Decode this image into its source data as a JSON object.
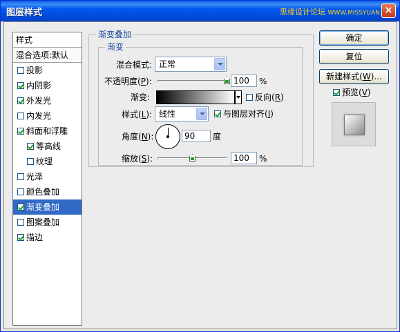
{
  "window": {
    "title": "图层样式",
    "watermark": "思缘设计论坛",
    "watermark_url": "WWW.MISSYUAN.COM",
    "close_glyph": "×"
  },
  "styles_list": {
    "header": "样式",
    "blend_options": "混合选项:默认",
    "items": [
      {
        "label": "投影",
        "checked": false,
        "sub": false,
        "selected": false
      },
      {
        "label": "内阴影",
        "checked": true,
        "sub": false,
        "selected": false
      },
      {
        "label": "外发光",
        "checked": true,
        "sub": false,
        "selected": false
      },
      {
        "label": "内发光",
        "checked": false,
        "sub": false,
        "selected": false
      },
      {
        "label": "斜面和浮雕",
        "checked": true,
        "sub": false,
        "selected": false
      },
      {
        "label": "等高线",
        "checked": true,
        "sub": true,
        "selected": false
      },
      {
        "label": "纹理",
        "checked": false,
        "sub": true,
        "selected": false
      },
      {
        "label": "光泽",
        "checked": false,
        "sub": false,
        "selected": false
      },
      {
        "label": "颜色叠加",
        "checked": false,
        "sub": false,
        "selected": false
      },
      {
        "label": "渐变叠加",
        "checked": true,
        "sub": false,
        "selected": true
      },
      {
        "label": "图案叠加",
        "checked": false,
        "sub": false,
        "selected": false
      },
      {
        "label": "描边",
        "checked": true,
        "sub": false,
        "selected": false
      }
    ]
  },
  "gradient_overlay": {
    "group_title": "渐变叠加",
    "subgroup_title": "渐变",
    "blend_mode_label": "混合模式:",
    "blend_mode_value": "正常",
    "opacity_label_pre": "不透明度(",
    "opacity_label_key": "P",
    "opacity_label_post": "):",
    "opacity_value": "100",
    "opacity_fraction": 1.0,
    "opacity_unit": "%",
    "gradient_label": "渐变:",
    "reverse_label_pre": "反向(",
    "reverse_label_key": "R",
    "reverse_label_post": ")",
    "reverse_checked": false,
    "style_label_pre": "样式(",
    "style_label_key": "L",
    "style_label_post": "):",
    "style_value": "线性",
    "align_label_pre": "与图层对齐(",
    "align_label_key": "I",
    "align_label_post": ")",
    "align_checked": true,
    "angle_label_pre": "角度(",
    "angle_label_key": "N",
    "angle_label_post": "):",
    "angle_value": "90",
    "angle_unit": "度",
    "scale_label_pre": "缩放(",
    "scale_label_key": "S",
    "scale_label_post": "):",
    "scale_value": "100",
    "scale_fraction": 0.5,
    "scale_unit": "%"
  },
  "buttons": {
    "ok": "确定",
    "reset": "复位",
    "new_style_pre": "新建样式(",
    "new_style_key": "W",
    "new_style_post": ")...",
    "preview_pre": "预览(",
    "preview_key": "V",
    "preview_post": ")",
    "preview_checked": true
  }
}
